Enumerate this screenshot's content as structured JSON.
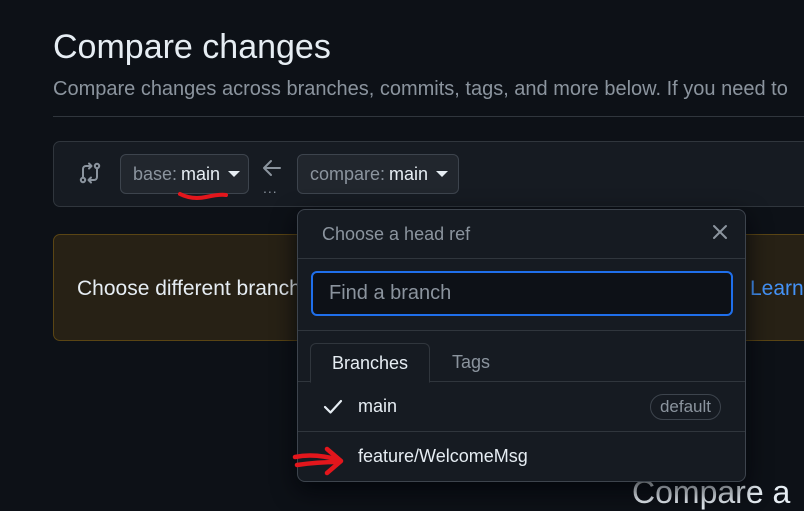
{
  "header": {
    "title": "Compare changes",
    "subtitle": "Compare changes across branches, commits, tags, and more below. If you need to"
  },
  "range": {
    "base_prefix": "base:",
    "base_value": "main",
    "compare_prefix": "compare:",
    "compare_value": "main",
    "ellipsis": "..."
  },
  "flash": {
    "text": "Choose different branches",
    "link": "Learn"
  },
  "popover": {
    "title": "Choose a head ref",
    "filter_placeholder": "Find a branch",
    "tabs": [
      {
        "label": "Branches",
        "selected": true
      },
      {
        "label": "Tags",
        "selected": false
      }
    ],
    "refs": [
      {
        "name": "main",
        "checked": true,
        "badge": "default"
      },
      {
        "name": "feature/WelcomeMsg",
        "checked": false,
        "badge": ""
      }
    ]
  },
  "bottom": {
    "heading": "Compare a"
  },
  "colors": {
    "background": "#0d1117",
    "accent": "#1f6feb",
    "link": "#4493f8",
    "annotation_red": "#e3161c",
    "flash_bg": "#272115"
  }
}
